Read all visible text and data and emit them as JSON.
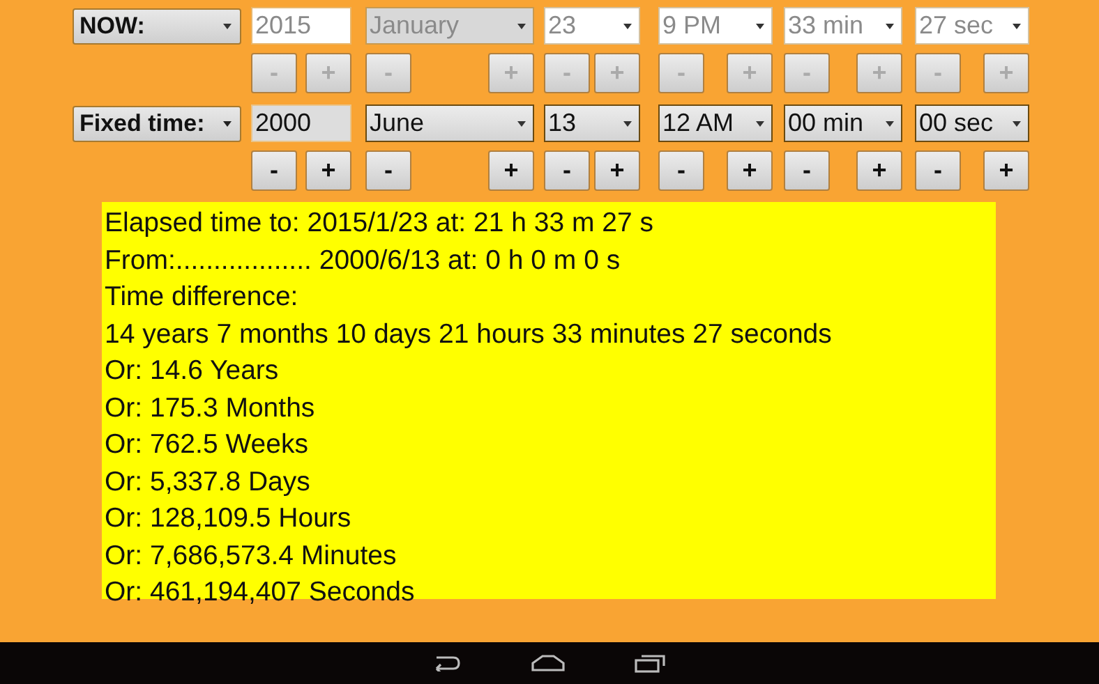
{
  "time_rows": [
    {
      "mode": "NOW:",
      "disabled": true,
      "fields": [
        {
          "kind": "input",
          "value": "2015",
          "minus": "-",
          "plus": "+"
        },
        {
          "kind": "button-select",
          "value": "January",
          "minus": "-",
          "plus": "+"
        },
        {
          "kind": "select",
          "value": "23",
          "minus": "-",
          "plus": "+"
        },
        {
          "kind": "select",
          "value": "9 PM",
          "minus": "-",
          "plus": "+"
        },
        {
          "kind": "select",
          "value": "33 min",
          "minus": "-",
          "plus": "+"
        },
        {
          "kind": "select",
          "value": "27 sec",
          "minus": "-",
          "plus": "+"
        }
      ]
    },
    {
      "mode": "Fixed time:",
      "disabled": false,
      "fields": [
        {
          "kind": "input",
          "value": "2000",
          "minus": "-",
          "plus": "+"
        },
        {
          "kind": "button-select",
          "value": "June",
          "minus": "-",
          "plus": "+"
        },
        {
          "kind": "select",
          "value": "13",
          "minus": "-",
          "plus": "+"
        },
        {
          "kind": "select",
          "value": "12 AM",
          "minus": "-",
          "plus": "+"
        },
        {
          "kind": "select",
          "value": "00 min",
          "minus": "-",
          "plus": "+"
        },
        {
          "kind": "select",
          "value": "00 sec",
          "minus": "-",
          "plus": "+"
        }
      ]
    }
  ],
  "results": [
    "Elapsed time to: 2015/1/23 at: 21 h 33 m 27 s",
    "From:.................. 2000/6/13 at: 0 h 0 m 0 s",
    "Time difference:",
    "14 years 7 months 10 days 21 hours 33 minutes 27 seconds",
    "Or: 14.6 Years",
    "Or: 175.3 Months",
    "Or: 762.5 Weeks",
    "Or: 5,337.8 Days",
    "Or: 128,109.5 Hours",
    "Or: 7,686,573.4 Minutes",
    "Or: 461,194,407 Seconds"
  ]
}
